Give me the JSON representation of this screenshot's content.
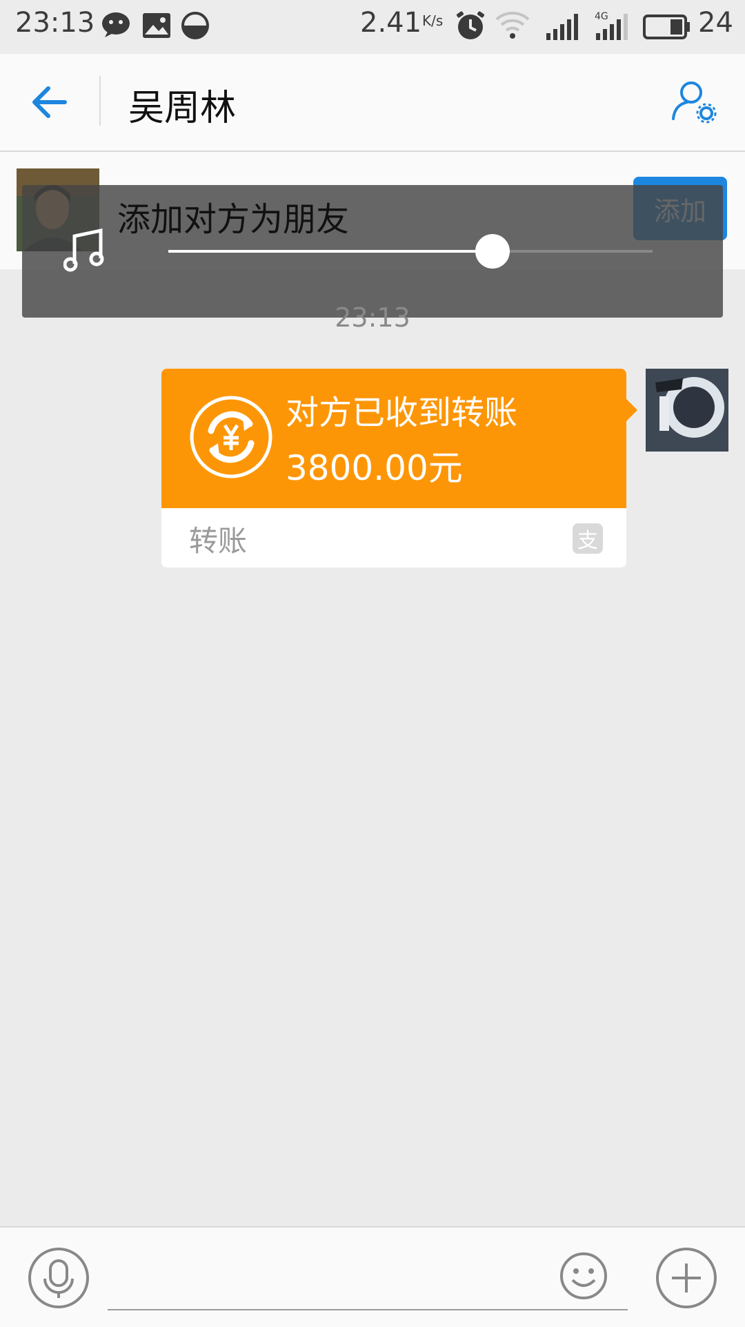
{
  "status_bar": {
    "time": "23:13",
    "net_speed": "2.41",
    "net_unit": "K/s",
    "network_type": "4G",
    "battery": "24",
    "icons": [
      "wechat-icon",
      "image-icon",
      "data-saver-icon",
      "alarm-icon",
      "wifi-icon",
      "signal-icon",
      "signal-4g-icon",
      "battery-icon"
    ]
  },
  "header": {
    "title": "吴周林"
  },
  "add_friend": {
    "label": "添加对方为朋友",
    "button": "添加"
  },
  "music_player": {
    "progress": 0.67
  },
  "chat": {
    "timestamp": "23:13",
    "transfer": {
      "status": "对方已收到转账",
      "amount": "3800.00元",
      "label": "转账"
    }
  },
  "colors": {
    "accent": "#1d86df",
    "transfer_orange": "#fd9607",
    "background": "#ebebeb"
  }
}
